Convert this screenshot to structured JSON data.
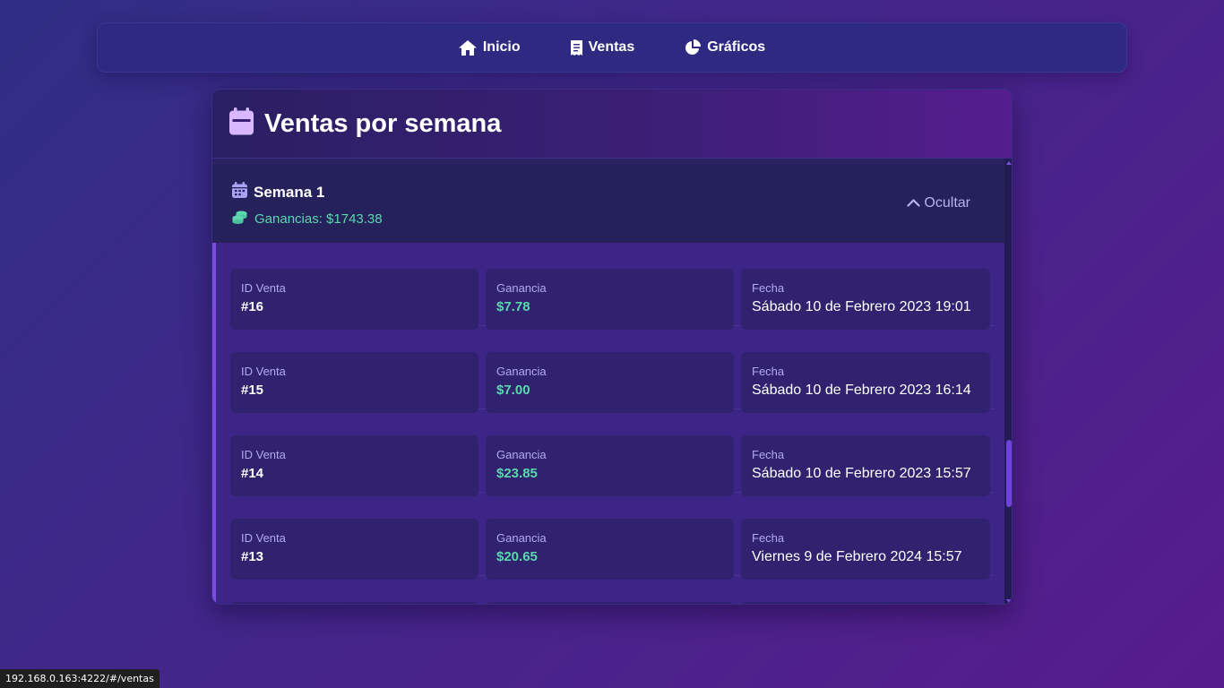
{
  "nav": {
    "items": [
      {
        "label": "Inicio",
        "icon": "home-icon"
      },
      {
        "label": "Ventas",
        "icon": "receipt-icon"
      },
      {
        "label": "Gráficos",
        "icon": "pie-chart-icon"
      }
    ]
  },
  "card": {
    "title": "Ventas por semana",
    "icon": "calendar-icon"
  },
  "week": {
    "title": "Semana 1",
    "profit": "Ganancias: $1743.38",
    "toggle_label": "Ocultar"
  },
  "labels": {
    "id": "ID Venta",
    "gain": "Ganancia",
    "date": "Fecha"
  },
  "sales": [
    {
      "id": "#16",
      "gain": "$7.78",
      "date": "Sábado 10 de Febrero 2023 19:01"
    },
    {
      "id": "#15",
      "gain": "$7.00",
      "date": "Sábado 10 de Febrero 2023 16:14"
    },
    {
      "id": "#14",
      "gain": "$23.85",
      "date": "Sábado 10 de Febrero 2023 15:57"
    },
    {
      "id": "#13",
      "gain": "$20.65",
      "date": "Viernes 9 de Febrero 2024 15:57"
    }
  ],
  "status_bar": {
    "url": "192.168.0.163:4222/#/ventas"
  },
  "colors": {
    "accent": "#7c4be0",
    "money": "#5ed6b0",
    "nav_bg": "#2e2a82"
  }
}
